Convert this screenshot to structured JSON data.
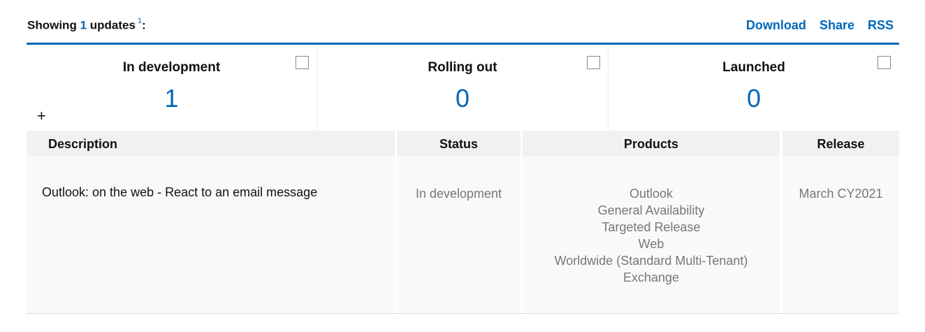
{
  "header": {
    "showing_prefix": "Showing",
    "count": "1",
    "suffix": "updates",
    "footnote": "1",
    "colon": ":",
    "actions": [
      "Download",
      "Share",
      "RSS"
    ]
  },
  "stats": [
    {
      "title": "In development",
      "value": "1"
    },
    {
      "title": "Rolling out",
      "value": "0"
    },
    {
      "title": "Launched",
      "value": "0"
    }
  ],
  "expand_icon": "+",
  "table": {
    "columns": [
      "Description",
      "Status",
      "Products",
      "Release"
    ],
    "rows": [
      {
        "description": "Outlook: on the web - React to an email message",
        "status": "In development",
        "products": [
          "Outlook",
          "General Availability",
          "Targeted Release",
          "Web",
          "Worldwide (Standard Multi-Tenant)",
          "Exchange"
        ],
        "release": "March CY2021"
      }
    ]
  },
  "colors": {
    "accent": "#0067b8",
    "header_bg": "#f1f1f1",
    "row_bg": "#f9f9f9",
    "muted_text": "#777777"
  }
}
